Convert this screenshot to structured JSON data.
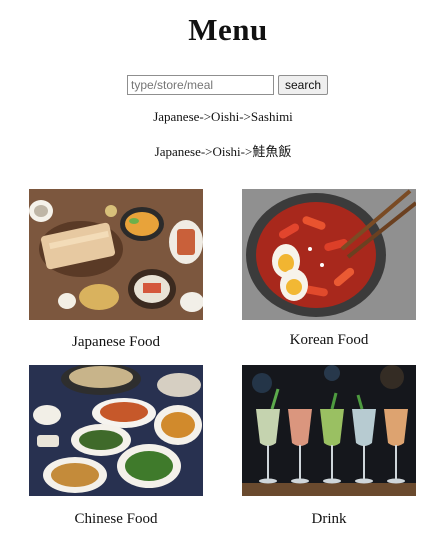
{
  "page": {
    "title": "Menu"
  },
  "search": {
    "placeholder": "type/store/meal",
    "value": "",
    "button_label": "search"
  },
  "breadcrumbs": [
    "Japanese->Oishi->Sashimi",
    "Japanese->Oishi->鮭魚飯"
  ],
  "categories": [
    {
      "label": "Japanese Food",
      "image": "japanese-food-photo"
    },
    {
      "label": "Korean Food",
      "image": "korean-food-photo"
    },
    {
      "label": "Chinese Food",
      "image": "chinese-food-photo"
    },
    {
      "label": "Drink",
      "image": "drink-photo"
    }
  ]
}
